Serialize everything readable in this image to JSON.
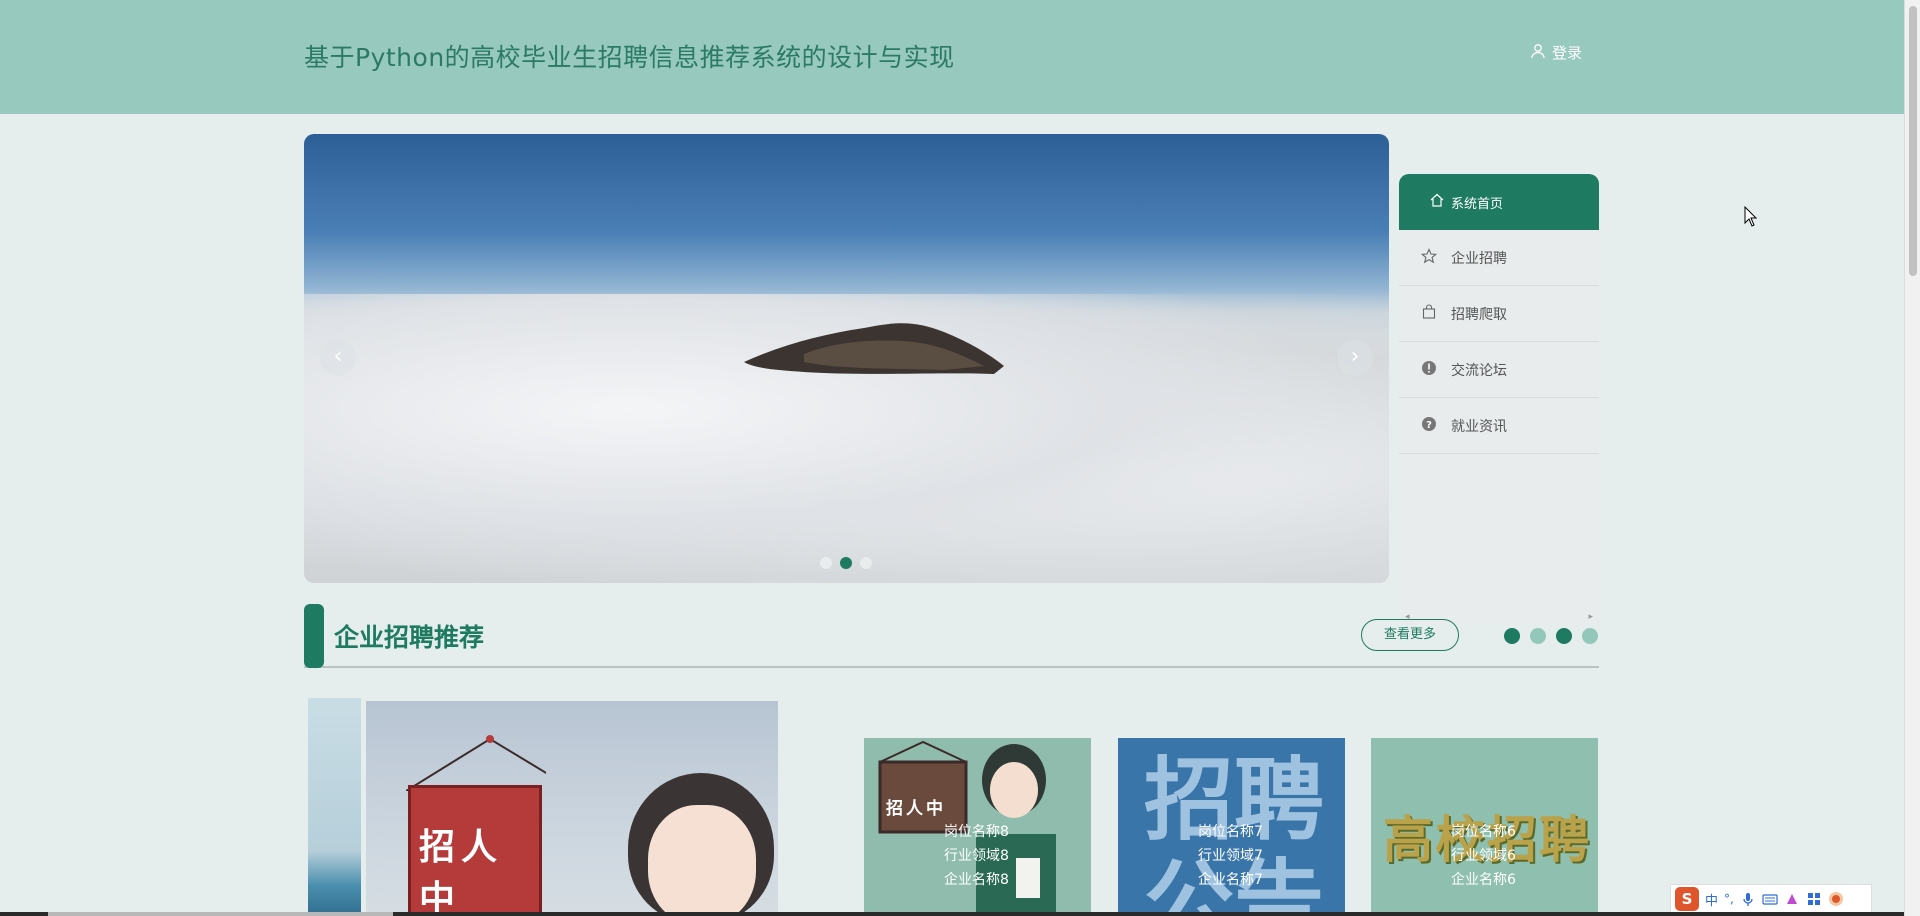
{
  "header": {
    "title": "基于Python的高校毕业生招聘信息推荐系统的设计与实现",
    "login_label": "登录",
    "background_color": "#98c9bf"
  },
  "carousel": {
    "prev_icon": "‹",
    "next_icon": "›",
    "slides": 3,
    "active_slide": 2
  },
  "sidebar": {
    "items": [
      {
        "label": "系统首页",
        "icon": "home-icon",
        "active": true
      },
      {
        "label": "企业招聘",
        "icon": "star-icon",
        "active": false
      },
      {
        "label": "招聘爬取",
        "icon": "bag-icon",
        "active": false
      },
      {
        "label": "交流论坛",
        "icon": "exclamation-icon",
        "active": false
      },
      {
        "label": "就业资讯",
        "icon": "question-icon",
        "active": false
      }
    ],
    "scroll_left": "◂",
    "scroll_right": "▸"
  },
  "section": {
    "title": "企业招聘推荐",
    "more_label": "查看更多",
    "dot_colors": [
      "#1e7a60",
      "#93c7b9",
      "#1e7a60",
      "#93c7b9"
    ]
  },
  "feature": {
    "banner_text": "招人中"
  },
  "cards": [
    {
      "position": "岗位名称8",
      "industry": "行业领域8",
      "company": "企业名称8",
      "sign_text": "招人中"
    },
    {
      "position": "岗位名称7",
      "industry": "行业领域7",
      "company": "企业名称7",
      "poster_text_1": "招聘",
      "poster_text_2": "公告"
    },
    {
      "position": "岗位名称6",
      "industry": "行业领域6",
      "company": "企业名称6",
      "poster_text": "高校招聘"
    }
  ],
  "taskbar": {
    "ime_logo": "S",
    "ime_lang": "中"
  },
  "colors": {
    "accent": "#1e7a60",
    "page_bg": "#e6eeed"
  }
}
